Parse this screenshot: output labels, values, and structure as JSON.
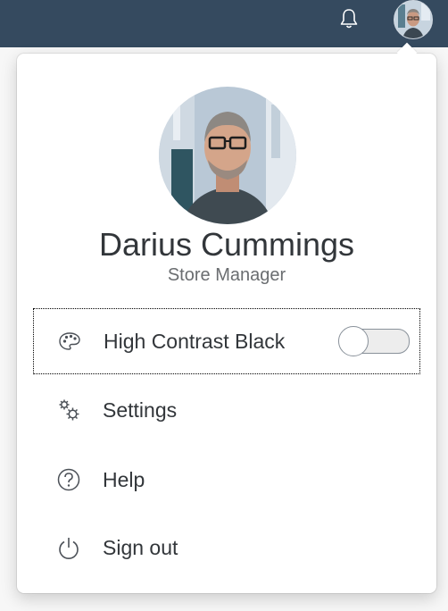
{
  "shellbar": {
    "notification_icon": "bell-icon",
    "colors": {
      "background": "#354a5f"
    }
  },
  "profile": {
    "name": "Darius Cummings",
    "role": "Store Manager"
  },
  "menu": {
    "high_contrast": {
      "label": "High Contrast Black",
      "icon": "palette-icon",
      "toggle_on": false
    },
    "settings": {
      "label": "Settings",
      "icon": "gears-icon"
    },
    "help": {
      "label": "Help",
      "icon": "question-circle-icon"
    },
    "sign_out": {
      "label": "Sign out",
      "icon": "power-icon"
    }
  }
}
